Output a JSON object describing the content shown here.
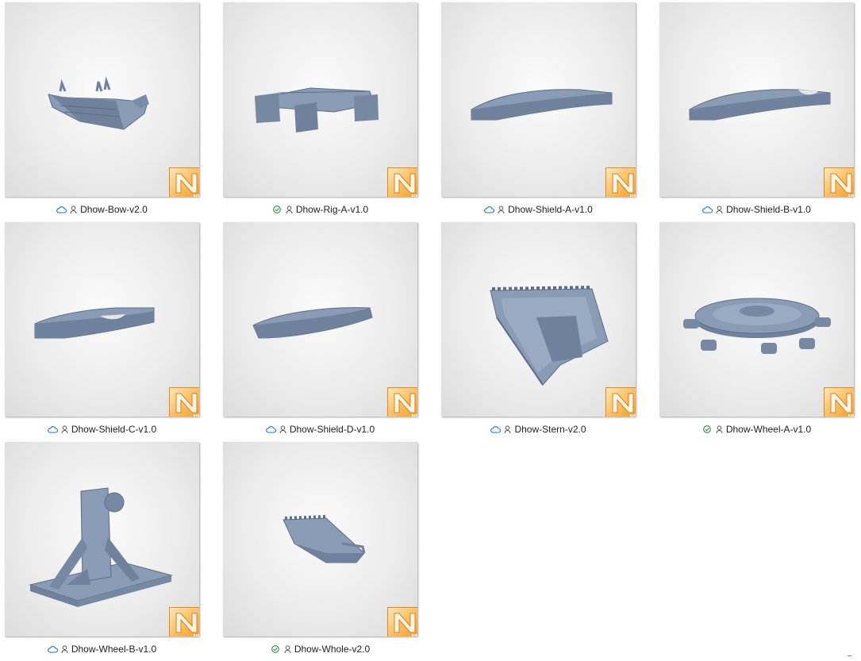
{
  "files": [
    {
      "name": "Dhow-Bow-v2.0",
      "status": "cloud-icon",
      "model": "bow"
    },
    {
      "name": "Dhow-Rig-A-v1.0",
      "status": "check-circle-icon",
      "model": "rig"
    },
    {
      "name": "Dhow-Shield-A-v1.0",
      "status": "cloud-icon",
      "model": "shield-a"
    },
    {
      "name": "Dhow-Shield-B-v1.0",
      "status": "cloud-icon",
      "model": "shield-b"
    },
    {
      "name": "Dhow-Shield-C-v1.0",
      "status": "cloud-icon",
      "model": "shield-c"
    },
    {
      "name": "Dhow-Shield-D-v1.0",
      "status": "cloud-icon",
      "model": "shield-d"
    },
    {
      "name": "Dhow-Stern-v2.0",
      "status": "cloud-icon",
      "model": "stern"
    },
    {
      "name": "Dhow-Wheel-A-v1.0",
      "status": "check-circle-icon",
      "model": "wheel-a"
    },
    {
      "name": "Dhow-Wheel-B-v1.0",
      "status": "cloud-icon",
      "model": "wheel-b"
    },
    {
      "name": "Dhow-Whole-v2.0",
      "status": "check-circle-icon",
      "model": "whole"
    }
  ],
  "badge": {
    "text": "NF",
    "icon": "autodesk-netfabb-icon"
  },
  "colors": {
    "cloud": "#1a73c8",
    "check": "#2e8b3e",
    "model": "#7e90ab",
    "badge": "#f6a636"
  }
}
